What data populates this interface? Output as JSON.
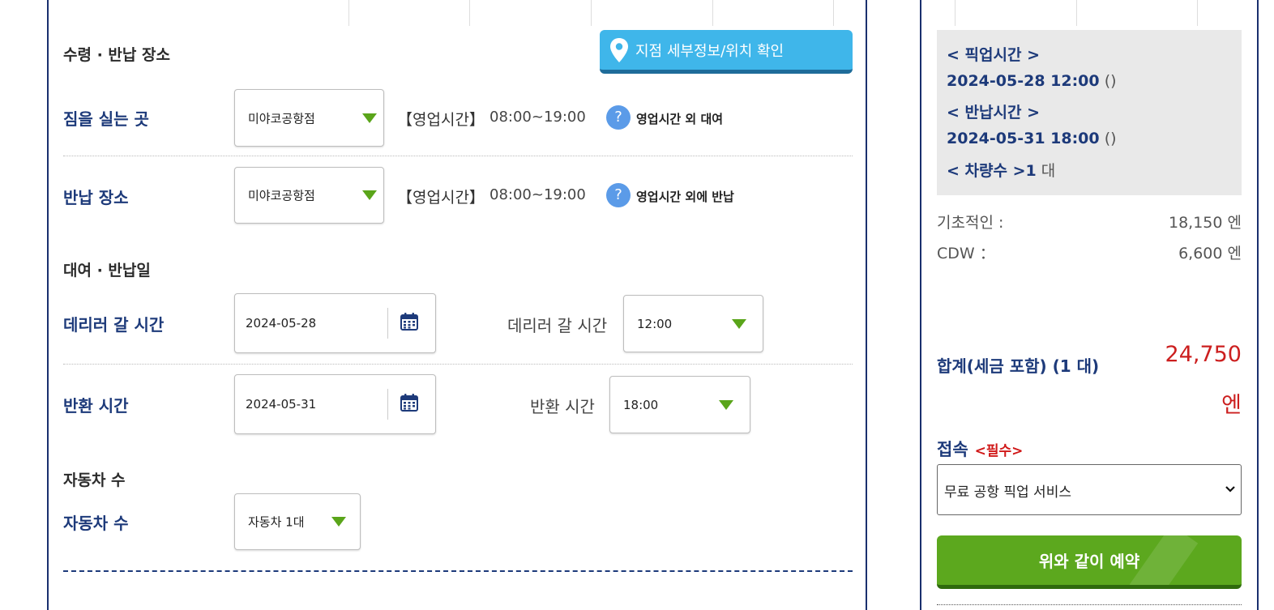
{
  "location_section": {
    "heading": "수령 · 반납 장소",
    "map_button_label": "지점 세부정보/위치 확인",
    "pickup": {
      "label": "짐을 실는 곳",
      "selected": "미야코공항점",
      "hours_label": "【영업시간】",
      "hours_value": "08:00~19:00",
      "help_text": "영업시간 외 대여"
    },
    "return": {
      "label": "반납 장소",
      "selected": "미야코공항점",
      "hours_label": "【영업시간】",
      "hours_value": "08:00~19:00",
      "help_text": "영업시간 외에 반납"
    }
  },
  "date_section": {
    "heading": "대여 · 반납일",
    "pickup": {
      "label": "데리러 갈 시간",
      "date": "2024-05-28",
      "time_caption": "데리러 갈 시간",
      "time": "12:00"
    },
    "return": {
      "label": "반환 시간",
      "date": "2024-05-31",
      "time_caption": "반환 시간",
      "time": "18:00"
    }
  },
  "car_section": {
    "heading": "자동차 수",
    "label": "자동차 수",
    "selected": "자동차 1대"
  },
  "summary": {
    "pickup_title": "< 픽업시간 >",
    "pickup_value": "2024-05-28 12:00",
    "pickup_paren": "()",
    "return_title": "< 반납시간 >",
    "return_value": "2024-05-31 18:00",
    "return_paren": "()",
    "cars_title": "< 차량수 >",
    "cars_value": "1",
    "cars_unit": "대"
  },
  "prices": {
    "base_label": "기초적인 :",
    "base_value": "18,150 엔",
    "cdw_label": "CDW ：",
    "cdw_value": "6,600 엔",
    "total_label": "합계(세금 포함) (1 대)",
    "total_amount": "24,750",
    "total_unit": "엔"
  },
  "connection": {
    "label": "접속",
    "required": "<필수>",
    "selected": "무료 공항 픽업 서비스"
  },
  "reserve_button": "위와 같이 예약",
  "colors": {
    "navy": "#1d3a7a",
    "accent_blue": "#3fb6ea",
    "green": "#5ca81e",
    "red": "#cc1f1f"
  },
  "icons": [
    "location-pin-icon",
    "help-icon",
    "calendar-icon",
    "dropdown-triangle-icon",
    "chevron-down-icon"
  ]
}
